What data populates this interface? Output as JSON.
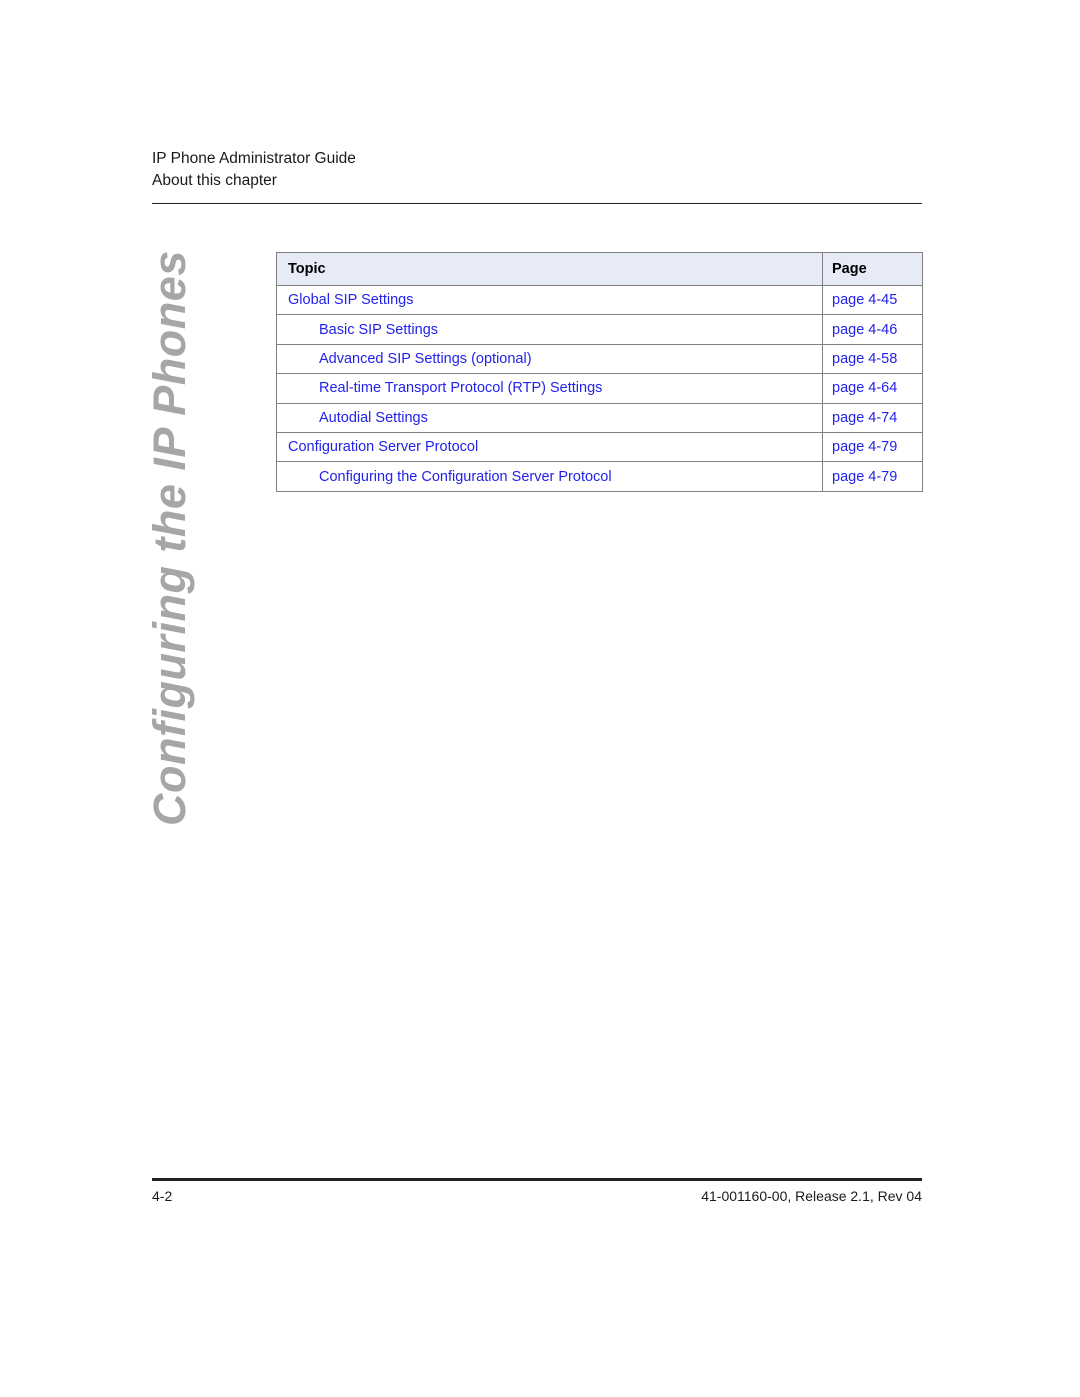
{
  "header": {
    "guide_title": "IP Phone Administrator Guide",
    "section_title": "About this chapter"
  },
  "chapter_tab": {
    "label": "Configuring the IP Phones",
    "color": "#a6a6a6"
  },
  "toc": {
    "columns": {
      "topic": "Topic",
      "page": "Page"
    },
    "header_bg": "#e6ebf7",
    "link_color": "#2222ee",
    "border_color": "#808080",
    "rows": [
      {
        "topic": "Global SIP Settings",
        "page": "page 4-45",
        "level": 1
      },
      {
        "topic": "Basic SIP Settings",
        "page": "page 4-46",
        "level": 2
      },
      {
        "topic": "Advanced SIP Settings (optional)",
        "page": "page 4-58",
        "level": 2
      },
      {
        "topic": "Real-time Transport Protocol (RTP) Settings",
        "page": "page 4-64",
        "level": 2
      },
      {
        "topic": "Autodial Settings",
        "page": "page 4-74",
        "level": 2
      },
      {
        "topic": "Configuration Server Protocol",
        "page": "page 4-79",
        "level": 1
      },
      {
        "topic": "Configuring the Configuration Server Protocol",
        "page": "page 4-79",
        "level": 2
      }
    ]
  },
  "footer": {
    "page_number": "4-2",
    "document_id": "41-001160-00, Release 2.1, Rev 04"
  }
}
